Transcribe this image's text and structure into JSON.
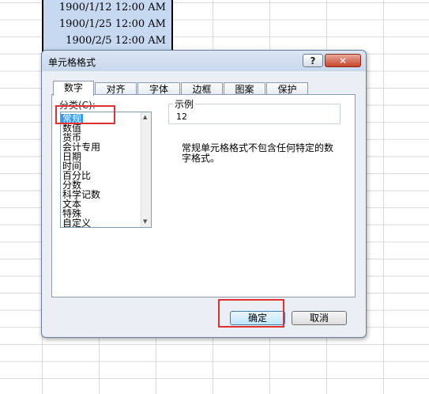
{
  "sheet": {
    "cells": [
      "1900/1/12 12:00 AM",
      "1900/1/25 12:00 AM",
      "1900/2/5 12:00 AM"
    ]
  },
  "dialog": {
    "title": "单元格格式",
    "help_label": "?",
    "close_label": "✕",
    "tabs": [
      {
        "label": "数字",
        "active": true
      },
      {
        "label": "对齐",
        "active": false
      },
      {
        "label": "字体",
        "active": false
      },
      {
        "label": "边框",
        "active": false
      },
      {
        "label": "图案",
        "active": false
      },
      {
        "label": "保护",
        "active": false
      }
    ],
    "category_label": "分类(C):",
    "categories": [
      "常规",
      "数值",
      "货币",
      "会计专用",
      "日期",
      "时间",
      "百分比",
      "分数",
      "科学记数",
      "文本",
      "特殊",
      "自定义"
    ],
    "selected_category": "常规",
    "sample_label": "示例",
    "sample_value": "12",
    "description": "常规单元格格式不包含任何特定的数字格式。",
    "ok_label": "确定",
    "cancel_label": "取消"
  },
  "colors": {
    "highlight": "#e03030",
    "selection": "#3399ff"
  }
}
